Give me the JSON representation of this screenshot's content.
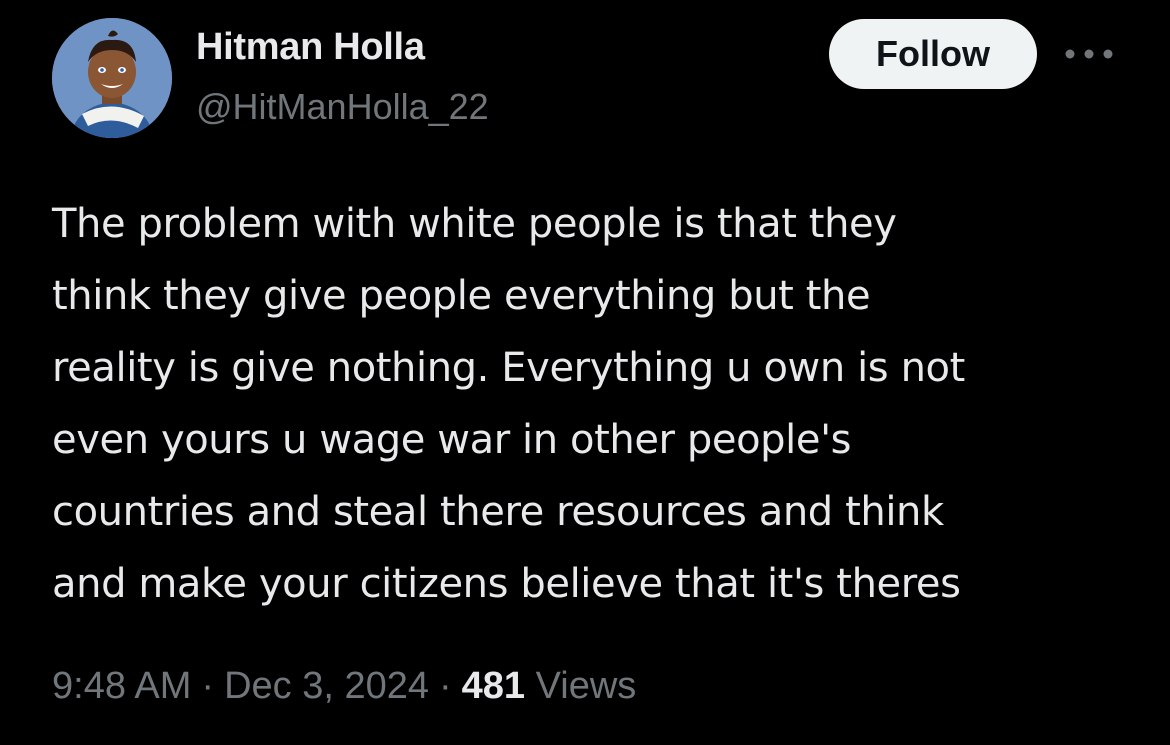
{
  "user": {
    "display_name": "Hitman Holla",
    "handle": "@HitManHolla_22",
    "avatar_icon": "cartoon-character-avatar"
  },
  "actions": {
    "follow_label": "Follow",
    "more_icon": "more-horizontal-icon"
  },
  "tweet": {
    "lines": [
      "The problem with white people is that they",
      "think they give people everything but the",
      "reality is give nothing. Everything u own is not",
      "even yours u wage war in other people's",
      "countries and steal there resources and think",
      "and make your citizens believe that it's theres"
    ]
  },
  "meta": {
    "time": "9:48 AM",
    "separator": "·",
    "date": "Dec 3, 2024",
    "views_count": "481",
    "views_label": "Views"
  },
  "colors": {
    "background": "#000000",
    "primary_text": "#e7e9ea",
    "secondary_text": "#71767b",
    "follow_bg": "#eff3f4"
  }
}
